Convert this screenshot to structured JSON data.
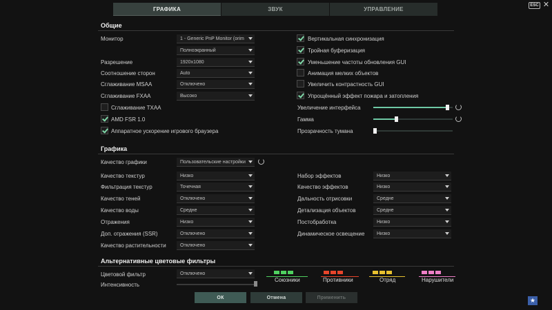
{
  "tabs": [
    {
      "label": "ГРАФИКА",
      "active": true
    },
    {
      "label": "ЗВУК",
      "active": false
    },
    {
      "label": "УПРАВЛЕНИЕ",
      "active": false
    }
  ],
  "top_right": {
    "esc_label": "ESC",
    "close_icon": "close-icon"
  },
  "general": {
    "title": "Общие",
    "monitor": {
      "label": "Монитор",
      "value": "1 - Generic PnP Monitor (orim",
      "mode": "Полноэкранный"
    },
    "resolution": {
      "label": "Разрешение",
      "value": "1920x1080"
    },
    "aspect": {
      "label": "Соотношение сторон",
      "value": "Auto"
    },
    "msaa": {
      "label": "Сглаживание MSAA",
      "value": "Отключено"
    },
    "fxaa": {
      "label": "Сглаживание FXAA",
      "value": "Высоко"
    },
    "txaa": {
      "label": "Сглаживание TXAA",
      "checked": false
    },
    "fsr": {
      "label": "AMD FSR 1.0",
      "checked": true
    },
    "browser_accel": {
      "label": "Аппаратное ускорение игрового браузера",
      "checked": true
    },
    "vsync": {
      "label": "Вертикальная синхронизация",
      "checked": true
    },
    "triple": {
      "label": "Тройная буферизация",
      "checked": true
    },
    "gui_rate": {
      "label": "Уменьшение частоты обновления GUI",
      "checked": true
    },
    "small_anim": {
      "label": "Анимация мелких объектов",
      "checked": false
    },
    "gui_contrast": {
      "label": "Увеличить контрастность GUI",
      "checked": false
    },
    "fire_effect": {
      "label": "Упрощённый эффект пожара и затопления",
      "checked": true
    },
    "ui_scale": {
      "label": "Увеличение интерфейса",
      "level": 0.95
    },
    "gamma": {
      "label": "Гамма",
      "level": 0.28
    },
    "fog": {
      "label": "Прозрачность тумана",
      "level": 0.0
    }
  },
  "graphics": {
    "title": "Графика",
    "quality": {
      "label": "Качество графики",
      "value": "Пользовательские настройки"
    },
    "left": [
      {
        "label": "Качество текстур",
        "value": "Низко"
      },
      {
        "label": "Фильтрация текстур",
        "value": "Точечная"
      },
      {
        "label": "Качество теней",
        "value": "Отключено"
      },
      {
        "label": "Качество воды",
        "value": "Средне"
      },
      {
        "label": "Отражения",
        "value": "Низко"
      },
      {
        "label": "Доп. отражения (SSR)",
        "value": "Отключено"
      },
      {
        "label": "Качество растительности",
        "value": "Отключено"
      }
    ],
    "right": [
      {
        "label": "Набор эффектов",
        "value": "Низко"
      },
      {
        "label": "Качество эффектов",
        "value": "Низко"
      },
      {
        "label": "Дальность отрисовки",
        "value": "Средне"
      },
      {
        "label": "Детализация объектов",
        "value": "Средне"
      },
      {
        "label": "Постобработка",
        "value": "Низко"
      },
      {
        "label": "Динамическое освещение",
        "value": "Низко"
      }
    ]
  },
  "color_filters": {
    "title": "Альтернативные цветовые фильтры",
    "filter": {
      "label": "Цветовой фильтр",
      "value": "Отключено"
    },
    "intensity": {
      "label": "Интенсивность",
      "level": 1.0
    },
    "groups": [
      {
        "label": "Союзники",
        "color": "#4fd160"
      },
      {
        "label": "Противники",
        "color": "#e8452b"
      },
      {
        "label": "Отряд",
        "color": "#e8c12f"
      },
      {
        "label": "Нарушители",
        "color": "#ee7fc7"
      }
    ]
  },
  "buttons": {
    "ok": "ОК",
    "cancel": "Отмена",
    "apply": "Применить"
  },
  "colors": {
    "accent": "#6fc9a5",
    "checkmark": "#7fd8a8"
  }
}
